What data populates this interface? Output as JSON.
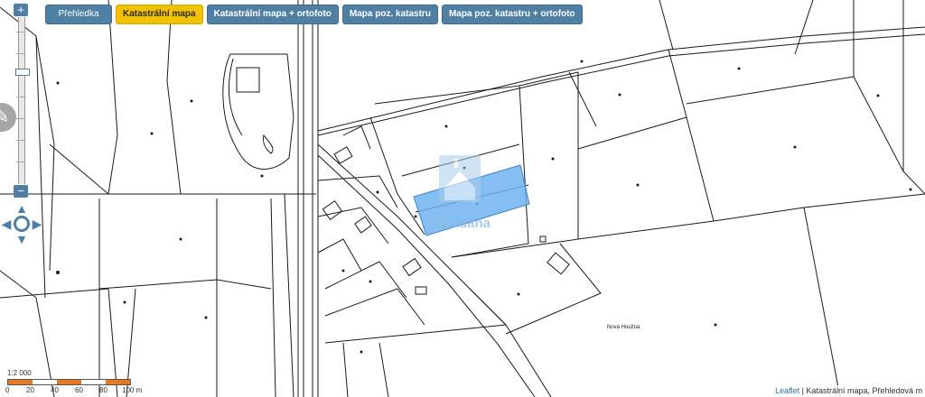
{
  "tabs": [
    {
      "label": "Přehledka",
      "active": false
    },
    {
      "label": "Katastrální mapa",
      "active": true
    },
    {
      "label": "Katastrální mapa + ortofoto",
      "active": false
    },
    {
      "label": "Mapa poz. katastru",
      "active": false
    },
    {
      "label": "Mapa poz. katastru + ortofoto",
      "active": false
    }
  ],
  "zoom": {
    "in_label": "+",
    "out_label": "−"
  },
  "map": {
    "place_label": "Nová Houžná",
    "watermark": "RKadana",
    "highlight_color": "#6fb3f0"
  },
  "scale": {
    "ratio": "1:2 000",
    "labels": [
      "0",
      "20",
      "40",
      "60",
      "80",
      "100 m"
    ]
  },
  "attribution": {
    "leaflet": "Leaflet",
    "text": " | Katastrální mapa, Přehledová m"
  },
  "colors": {
    "tab": "#4f7fa3",
    "tab_active": "#f2c200",
    "scale_orange": "#e57a22"
  }
}
